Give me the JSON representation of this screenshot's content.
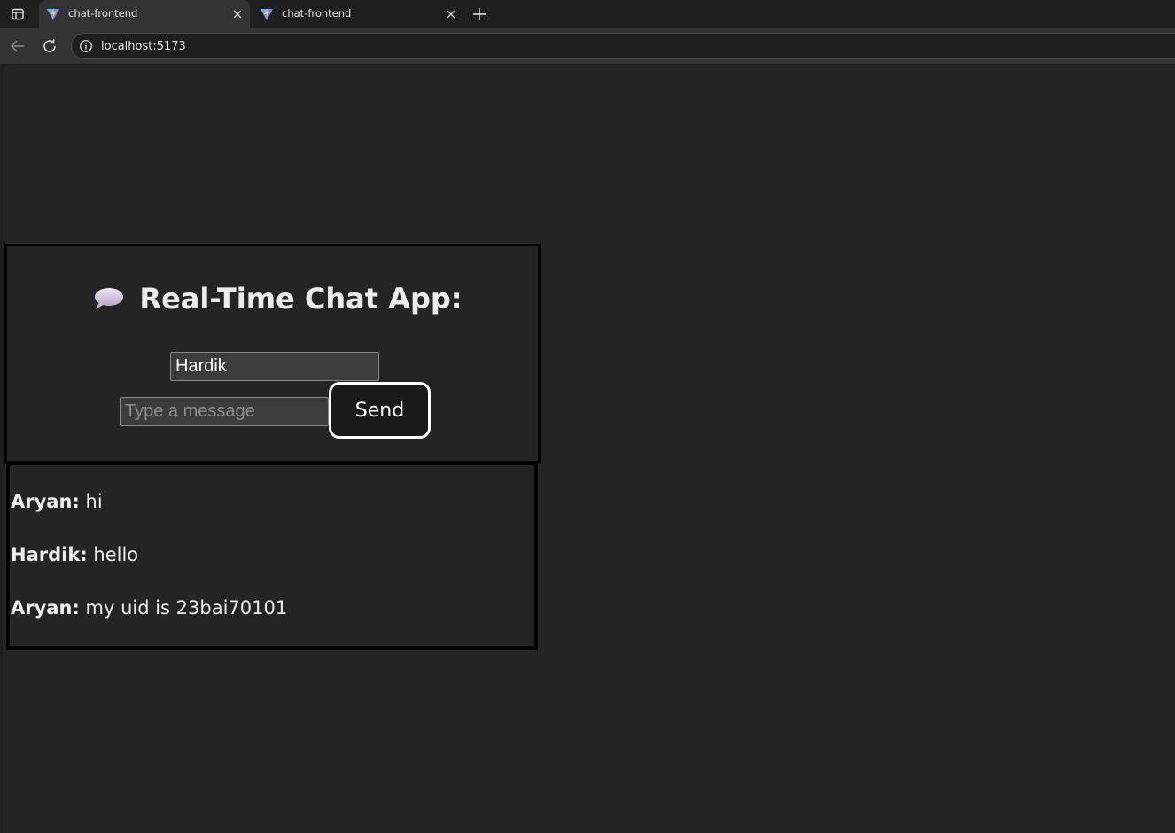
{
  "browser": {
    "tabs": [
      {
        "title": "chat-frontend",
        "active": true
      },
      {
        "title": "chat-frontend",
        "active": false
      }
    ],
    "url": "localhost:5173"
  },
  "app": {
    "title": "Real-Time Chat App:",
    "title_icon": "speech-bubble-icon",
    "username_value": "Hardik",
    "message_placeholder": "Type a message",
    "message_value": "",
    "send_label": "Send"
  },
  "messages": [
    {
      "sender": "Aryan:",
      "text": "hi"
    },
    {
      "sender": "Hardik:",
      "text": "hello"
    },
    {
      "sender": "Aryan:",
      "text": "my uid is 23bai70101"
    }
  ],
  "colors": {
    "page_background": "#242424",
    "chrome_background": "#1f1f1f",
    "toolbar_background": "#333333",
    "button_background": "#1a1a1a",
    "text": "#ececec",
    "panel_border": "#000000"
  }
}
